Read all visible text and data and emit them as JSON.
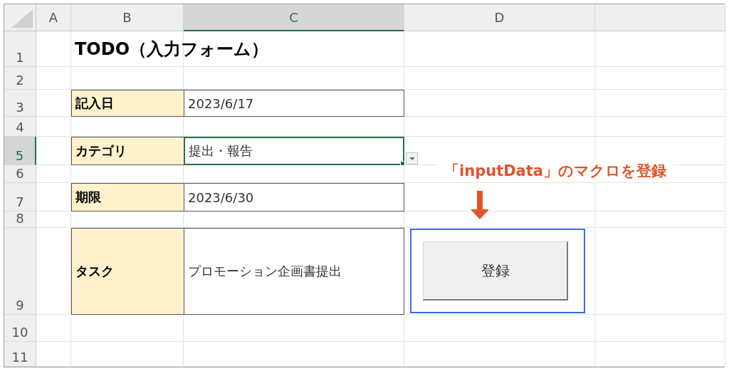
{
  "column_headers": [
    {
      "label": "A",
      "selected": false
    },
    {
      "label": "B",
      "selected": false
    },
    {
      "label": "C",
      "selected": true
    },
    {
      "label": "D",
      "selected": false
    }
  ],
  "row_headers": [
    {
      "label": "1",
      "selected": false
    },
    {
      "label": "2",
      "selected": false
    },
    {
      "label": "3",
      "selected": false
    },
    {
      "label": "4",
      "selected": false
    },
    {
      "label": "5",
      "selected": true
    },
    {
      "label": "6",
      "selected": false
    },
    {
      "label": "7",
      "selected": false
    },
    {
      "label": "8",
      "selected": false
    },
    {
      "label": "9",
      "selected": false
    },
    {
      "label": "10",
      "selected": false
    },
    {
      "label": "11",
      "selected": false
    }
  ],
  "title": "TODO（入力フォーム）",
  "fields": [
    {
      "label": "記入日",
      "value": "2023/6/17",
      "selected": false
    },
    {
      "label": "カテゴリ",
      "value": "提出・報告",
      "selected": true
    },
    {
      "label": "期限",
      "value": "2023/6/30",
      "selected": false
    },
    {
      "label": "タスク",
      "value": "プロモーション企画書提出",
      "selected": false
    }
  ],
  "annotation": "「inputData」のマクロを登録",
  "button": {
    "label": "登録",
    "selected": true
  }
}
